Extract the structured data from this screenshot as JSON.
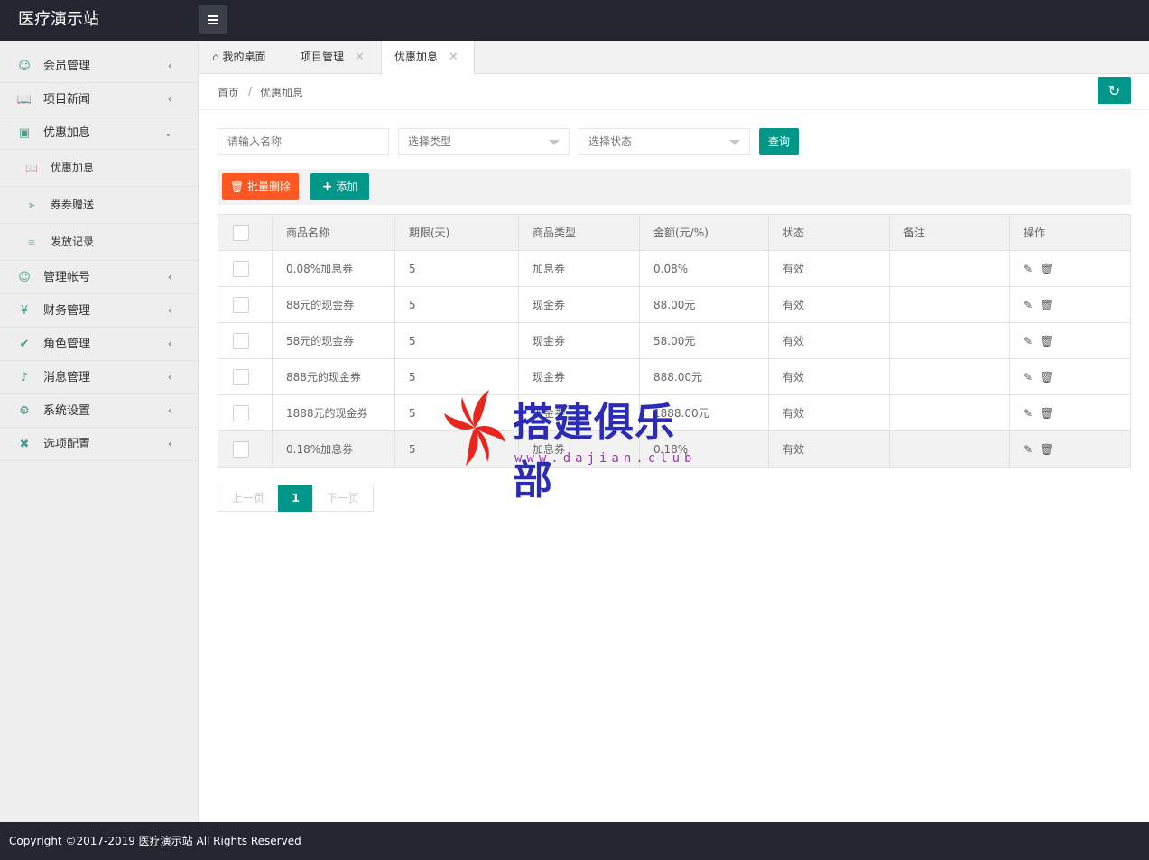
{
  "app": {
    "title": "医疗演示站"
  },
  "sidebar": {
    "items": [
      {
        "label": "会员管理",
        "icon": "user-icon",
        "expanded": false
      },
      {
        "label": "项目新闻",
        "icon": "book-icon",
        "expanded": false
      },
      {
        "label": "优惠加息",
        "icon": "image-icon",
        "expanded": true,
        "children": [
          {
            "label": "优惠加息",
            "icon": "book-icon"
          },
          {
            "label": "券券赠送",
            "icon": "send-icon"
          },
          {
            "label": "发放记录",
            "icon": "list-icon"
          }
        ]
      },
      {
        "label": "管理帐号",
        "icon": "users-icon",
        "expanded": false
      },
      {
        "label": "财务管理",
        "icon": "yen-icon",
        "expanded": false
      },
      {
        "label": "角色管理",
        "icon": "shield-icon",
        "expanded": false
      },
      {
        "label": "消息管理",
        "icon": "speaker-icon",
        "expanded": false
      },
      {
        "label": "系统设置",
        "icon": "gear-icon",
        "expanded": false
      },
      {
        "label": "选项配置",
        "icon": "tools-icon",
        "expanded": false
      }
    ]
  },
  "tabs": [
    {
      "label": "我的桌面",
      "icon": "home-icon",
      "closable": false
    },
    {
      "label": "项目管理",
      "closable": true
    },
    {
      "label": "优惠加息",
      "closable": true,
      "active": true
    }
  ],
  "breadcrumb": {
    "home": "首页",
    "sep": "/",
    "current": "优惠加息"
  },
  "search": {
    "name_placeholder": "请输入名称",
    "type_placeholder": "选择类型",
    "status_placeholder": "选择状态",
    "query_label": "查询"
  },
  "toolbar": {
    "batch_delete_label": "批量删除",
    "add_label": "添加"
  },
  "table": {
    "headers": [
      "商品名称",
      "期限(天)",
      "商品类型",
      "金额(元/%)",
      "状态",
      "备注",
      "操作"
    ],
    "rows": [
      {
        "name": "0.08%加息券",
        "days": "5",
        "type": "加息券",
        "amount": "0.08%",
        "status": "有效",
        "note": ""
      },
      {
        "name": "88元的现金券",
        "days": "5",
        "type": "现金券",
        "amount": "88.00元",
        "status": "有效",
        "note": ""
      },
      {
        "name": "58元的现金券",
        "days": "5",
        "type": "现金券",
        "amount": "58.00元",
        "status": "有效",
        "note": ""
      },
      {
        "name": "888元的现金券",
        "days": "5",
        "type": "现金券",
        "amount": "888.00元",
        "status": "有效",
        "note": ""
      },
      {
        "name": "1888元的现金券",
        "days": "5",
        "type": "现金券",
        "amount": "1888.00元",
        "status": "有效",
        "note": ""
      },
      {
        "name": "0.18%加息券",
        "days": "5",
        "type": "加息券",
        "amount": "0.18%",
        "status": "有效",
        "note": ""
      }
    ]
  },
  "pager": {
    "prev": "上一页",
    "current": "1",
    "next": "下一页"
  },
  "watermark": {
    "text": "搭建俱乐部",
    "url": "www.dajian.club"
  },
  "footer": {
    "copyright": "Copyright ©2017-2019 医疗演示站 All Rights Reserved"
  },
  "colors": {
    "header_bg": "#23262e",
    "accent": "#009688",
    "danger": "#ff5722",
    "sidebar_bg": "#eeeeee"
  }
}
